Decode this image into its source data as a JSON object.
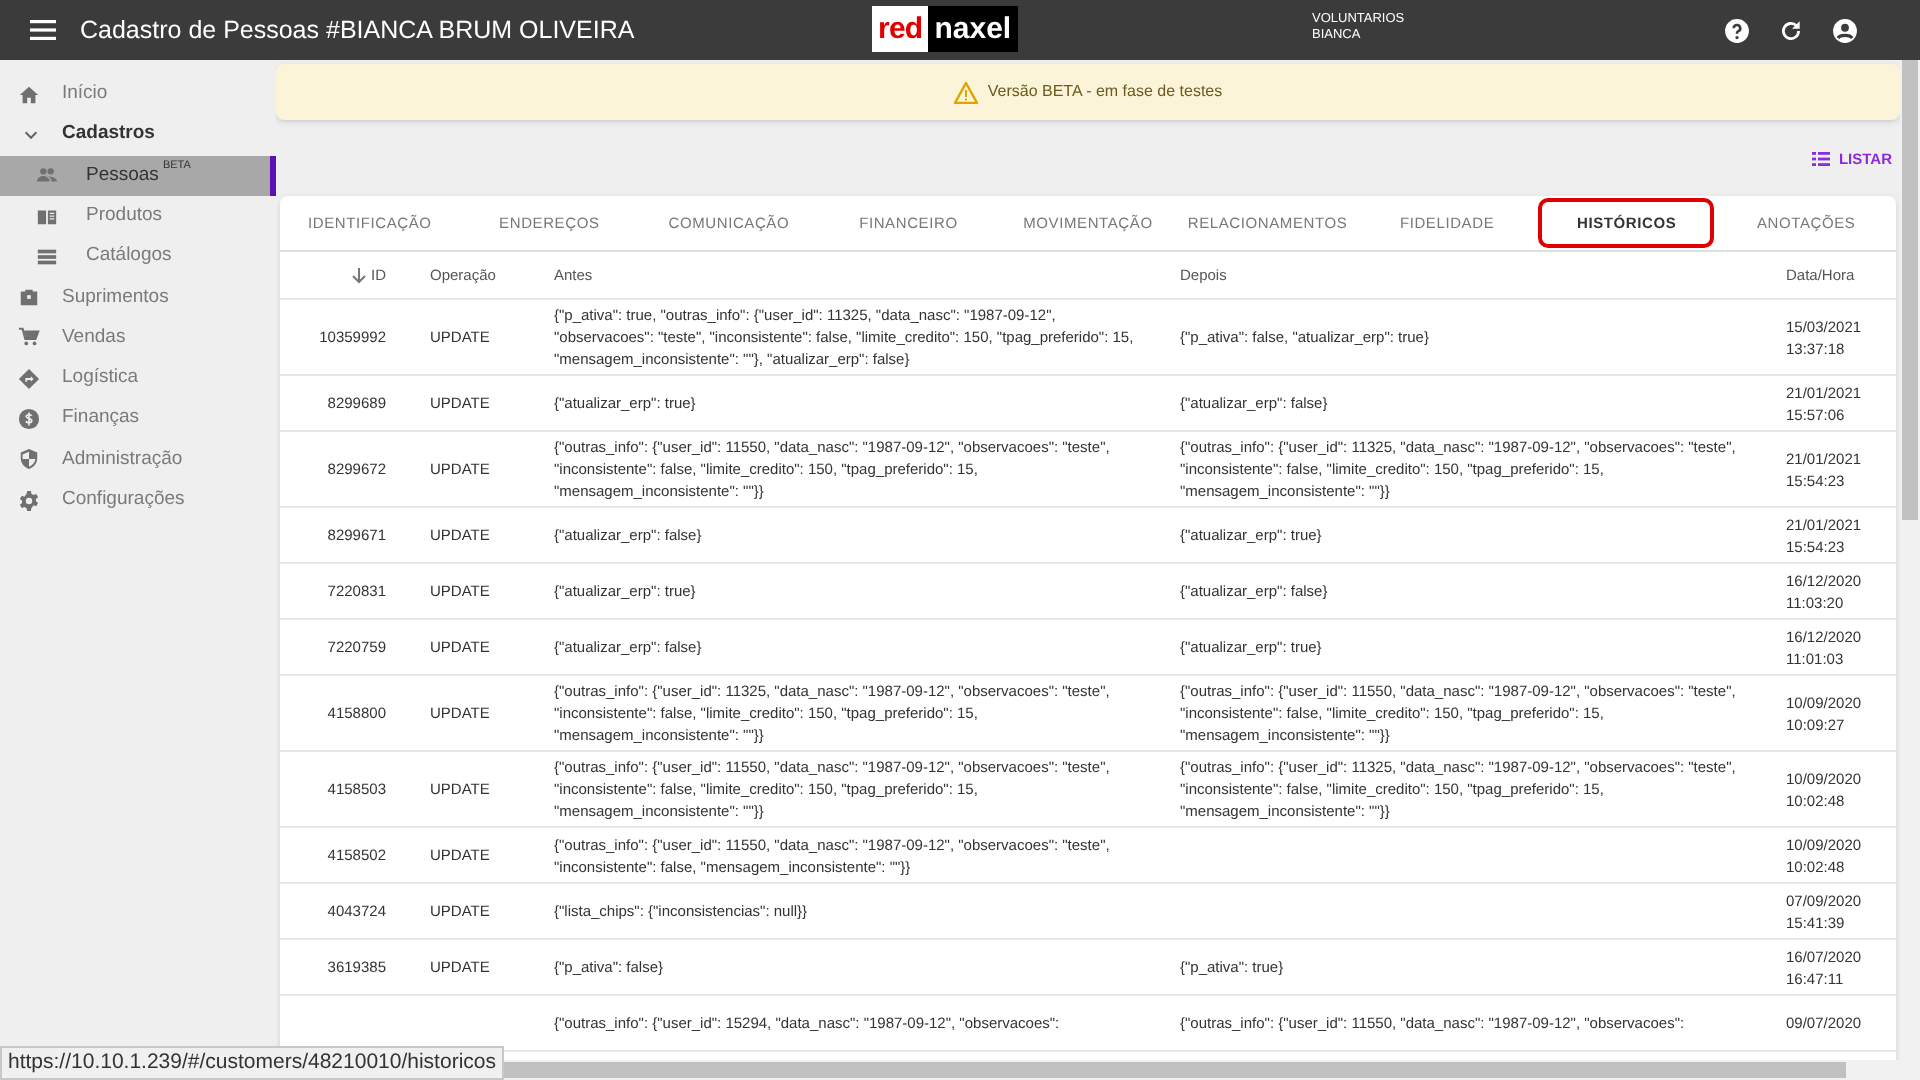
{
  "app_bar": {
    "title": "Cadastro de Pessoas #BIANCA BRUM OLIVEIRA",
    "logo": {
      "part_1": "red",
      "part_2": "naxel"
    },
    "org": "VOLUNTARIOS",
    "user": "BIANCA"
  },
  "sidebar": {
    "items": [
      {
        "label": "Início",
        "kind": "home",
        "selected": false
      },
      {
        "label": "Cadastros",
        "expanded": true,
        "children": [
          {
            "label": "Pessoas",
            "badge": "BETA",
            "kind": "people",
            "selected": true
          },
          {
            "label": "Produtos",
            "kind": "book",
            "selected": false
          },
          {
            "label": "Catálogos",
            "kind": "list",
            "selected": false
          }
        ]
      },
      {
        "label": "Suprimentos",
        "kind": "case",
        "selected": false
      },
      {
        "label": "Vendas",
        "kind": "cart",
        "selected": false
      },
      {
        "label": "Logística",
        "kind": "route",
        "selected": false
      },
      {
        "label": "Finanças",
        "kind": "money",
        "selected": false
      },
      {
        "label": "Administração",
        "kind": "shield",
        "selected": false
      },
      {
        "label": "Configurações",
        "kind": "gear",
        "selected": false
      }
    ]
  },
  "banner": {
    "text": "Versão BETA - em fase de testes"
  },
  "list_button": "LISTAR",
  "tabs": [
    {
      "label": "IDENTIFICAÇÃO",
      "selected": false
    },
    {
      "label": "ENDEREÇOS",
      "selected": false
    },
    {
      "label": "COMUNICAÇÃO",
      "selected": false
    },
    {
      "label": "FINANCEIRO",
      "selected": false
    },
    {
      "label": "MOVIMENTAÇÃO",
      "selected": false
    },
    {
      "label": "RELACIONAMENTOS",
      "selected": false
    },
    {
      "label": "FIDELIDADE",
      "selected": false
    },
    {
      "label": "HISTÓRICOS",
      "selected": true
    },
    {
      "label": "ANOTAÇÕES",
      "selected": false
    }
  ],
  "table": {
    "columns": [
      {
        "label": "ID",
        "sorted": true
      },
      {
        "label": "Operação",
        "sorted": false
      },
      {
        "label": "Antes",
        "sorted": false
      },
      {
        "label": "Depois",
        "sorted": false
      },
      {
        "label": "Data/Hora",
        "sorted": false
      }
    ],
    "rows": [
      {
        "id": "10359992",
        "operation": "UPDATE",
        "before": "{\"p_ativa\": true, \"outras_info\": {\"user_id\": 11325, \"data_nasc\": \"1987-09-12\", \"observacoes\": \"teste\", \"inconsistente\": false, \"limite_credito\": 150, \"tpag_preferido\": 15, \"mensagem_inconsistente\": \"\"}, \"atualizar_erp\": false}",
        "after": "{\"p_ativa\": false, \"atualizar_erp\": true}",
        "date": "15/03/2021",
        "time": "13:37:18"
      },
      {
        "id": "8299689",
        "operation": "UPDATE",
        "before": "{\"atualizar_erp\": true}",
        "after": "{\"atualizar_erp\": false}",
        "date": "21/01/2021",
        "time": "15:57:06"
      },
      {
        "id": "8299672",
        "operation": "UPDATE",
        "before": "{\"outras_info\": {\"user_id\": 11550, \"data_nasc\": \"1987-09-12\", \"observacoes\": \"teste\", \"inconsistente\": false, \"limite_credito\": 150, \"tpag_preferido\": 15, \"mensagem_inconsistente\": \"\"}}",
        "after": "{\"outras_info\": {\"user_id\": 11325, \"data_nasc\": \"1987-09-12\", \"observacoes\": \"teste\", \"inconsistente\": false, \"limite_credito\": 150, \"tpag_preferido\": 15, \"mensagem_inconsistente\": \"\"}}",
        "date": "21/01/2021",
        "time": "15:54:23"
      },
      {
        "id": "8299671",
        "operation": "UPDATE",
        "before": "{\"atualizar_erp\": false}",
        "after": "{\"atualizar_erp\": true}",
        "date": "21/01/2021",
        "time": "15:54:23"
      },
      {
        "id": "7220831",
        "operation": "UPDATE",
        "before": "{\"atualizar_erp\": true}",
        "after": "{\"atualizar_erp\": false}",
        "date": "16/12/2020",
        "time": "11:03:20"
      },
      {
        "id": "7220759",
        "operation": "UPDATE",
        "before": "{\"atualizar_erp\": false}",
        "after": "{\"atualizar_erp\": true}",
        "date": "16/12/2020",
        "time": "11:01:03"
      },
      {
        "id": "4158800",
        "operation": "UPDATE",
        "before": "{\"outras_info\": {\"user_id\": 11325, \"data_nasc\": \"1987-09-12\", \"observacoes\": \"teste\", \"inconsistente\": false, \"limite_credito\": 150, \"tpag_preferido\": 15, \"mensagem_inconsistente\": \"\"}}",
        "after": "{\"outras_info\": {\"user_id\": 11550, \"data_nasc\": \"1987-09-12\", \"observacoes\": \"teste\", \"inconsistente\": false, \"limite_credito\": 150, \"tpag_preferido\": 15, \"mensagem_inconsistente\": \"\"}}",
        "date": "10/09/2020",
        "time": "10:09:27"
      },
      {
        "id": "4158503",
        "operation": "UPDATE",
        "before": "{\"outras_info\": {\"user_id\": 11550, \"data_nasc\": \"1987-09-12\", \"observacoes\": \"teste\", \"inconsistente\": false, \"limite_credito\": 150, \"tpag_preferido\": 15, \"mensagem_inconsistente\": \"\"}}",
        "after": "{\"outras_info\": {\"user_id\": 11325, \"data_nasc\": \"1987-09-12\", \"observacoes\": \"teste\", \"inconsistente\": false, \"limite_credito\": 150, \"tpag_preferido\": 15, \"mensagem_inconsistente\": \"\"}}",
        "date": "10/09/2020",
        "time": "10:02:48"
      },
      {
        "id": "4158502",
        "operation": "UPDATE",
        "before": "{\"outras_info\": {\"user_id\": 11550, \"data_nasc\": \"1987-09-12\", \"observacoes\": \"teste\", \"inconsistente\": false, \"mensagem_inconsistente\": \"\"}}",
        "date": "10/09/2020",
        "time": "10:02:48"
      },
      {
        "id": "4043724",
        "operation": "UPDATE",
        "before": "{\"lista_chips\": {\"inconsistencias\": null}}",
        "date": "07/09/2020",
        "time": "15:41:39"
      },
      {
        "id": "3619385",
        "operation": "UPDATE",
        "before": "{\"p_ativa\": false}",
        "after": "{\"p_ativa\": true}",
        "date": "16/07/2020",
        "time": "16:47:11"
      },
      {
        "before": "{\"outras_info\": {\"user_id\": 15294, \"data_nasc\": \"1987-09-12\", \"observacoes\":",
        "after": "{\"outras_info\": {\"user_id\": 11550, \"data_nasc\": \"1987-09-12\", \"observacoes\":",
        "date": "09/07/2020"
      }
    ]
  },
  "status_url": "https://10.10.1.239/#/customers/48210010/historicos"
}
